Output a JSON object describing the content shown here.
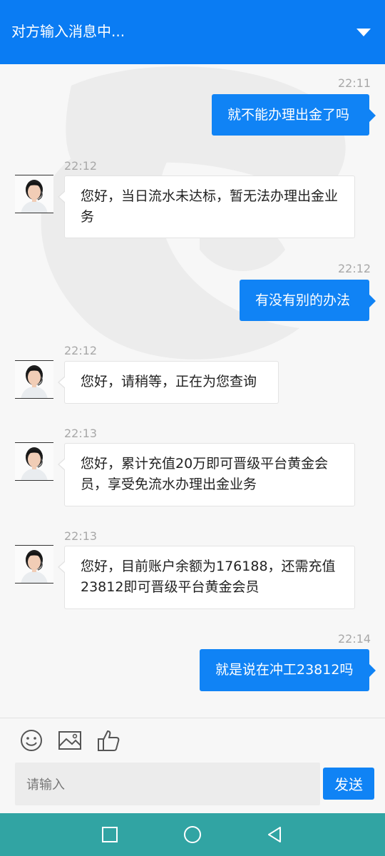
{
  "header": {
    "title": "对方输入消息中...",
    "caret_icon": "chevron-down-icon"
  },
  "messages": [
    {
      "direction": "out",
      "time": "22:11",
      "text": "就不能办理出金了吗"
    },
    {
      "direction": "in",
      "time": "22:12",
      "text": "您好，当日流水未达标，暂无法办理出金业务"
    },
    {
      "direction": "out",
      "time": "22:12",
      "text": "有没有别的办法"
    },
    {
      "direction": "in",
      "time": "22:12",
      "text": "您好，请稍等，正在为您查询"
    },
    {
      "direction": "in",
      "time": "22:13",
      "text": "您好，累计充值20万即可晋级平台黄金会员，享受免流水办理出金业务"
    },
    {
      "direction": "in",
      "time": "22:13",
      "text": "您好，目前账户余额为176188，还需充值23812即可晋级平台黄金会员"
    },
    {
      "direction": "out",
      "time": "22:14",
      "text": "就是说在冲工23812吗"
    }
  ],
  "toolbar": {
    "emoji_icon": "emoji-icon",
    "image_icon": "image-icon",
    "like_icon": "thumbs-up-icon"
  },
  "composer": {
    "placeholder": "请输入",
    "send_label": "发送"
  },
  "navbar": {
    "icons": [
      "square-icon",
      "circle-icon",
      "back-triangle-icon"
    ]
  },
  "colors": {
    "header": "#0a7cf3",
    "out_bubble": "#1083f5",
    "navbar": "#31a4a3"
  }
}
